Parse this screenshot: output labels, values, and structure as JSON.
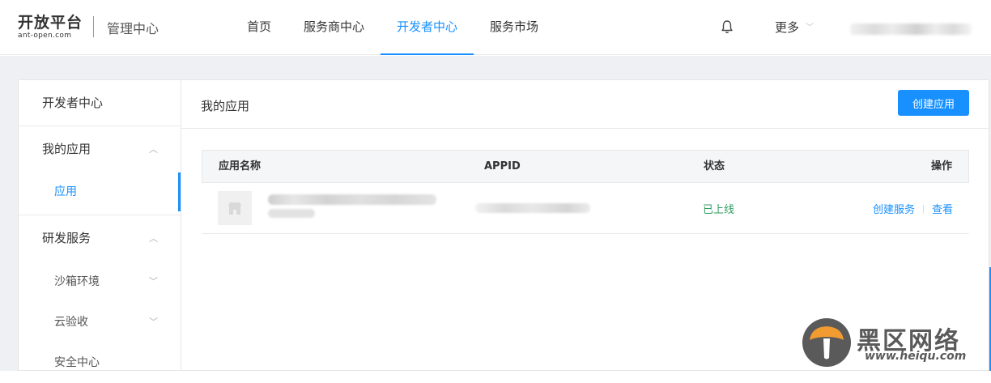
{
  "header": {
    "logo_main": "开放平台",
    "logo_sub": "ant-open.com",
    "admin_title": "管理中心",
    "nav": [
      "首页",
      "服务商中心",
      "开发者中心",
      "服务市场"
    ],
    "active_nav": "开发者中心",
    "more_label": "更多"
  },
  "sidebar": {
    "title": "开发者中心",
    "group_apps": "我的应用",
    "item_apps": "应用",
    "group_dev": "研发服务",
    "item_sandbox": "沙箱环境",
    "item_cloud": "云验收",
    "item_security": "安全中心"
  },
  "main": {
    "title": "我的应用",
    "create_button": "创建应用",
    "columns": {
      "name": "应用名称",
      "appid": "APPID",
      "status": "状态",
      "ops": "操作"
    },
    "rows": [
      {
        "status": "已上线",
        "op_create_service": "创建服务",
        "op_view": "查看"
      }
    ]
  },
  "watermark": {
    "text": "黑区网络",
    "url": "www.heiqu.com"
  },
  "colors": {
    "accent": "#1890ff",
    "status_online": "#2f9d5e",
    "page_background": "#eef0f3"
  }
}
